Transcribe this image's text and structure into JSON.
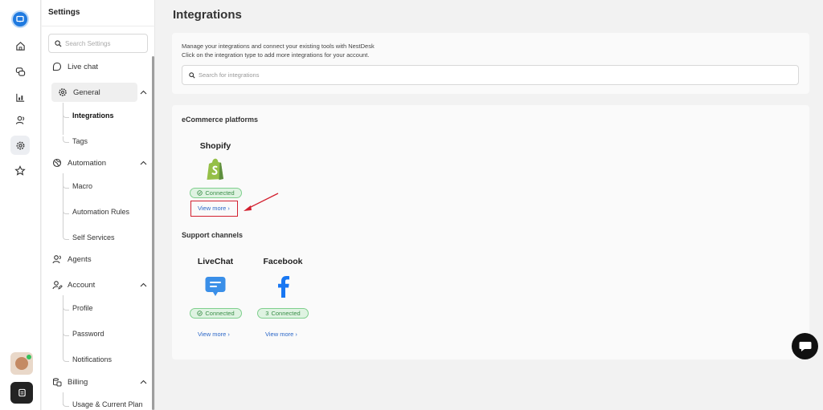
{
  "settings": {
    "title": "Settings",
    "search_placeholder": "Search Settings",
    "nav": {
      "live_chat": "Live chat",
      "general": "General",
      "integrations": "Integrations",
      "tags": "Tags",
      "automation": "Automation",
      "macro": "Macro",
      "automation_rules": "Automation Rules",
      "self_services": "Self Services",
      "agents": "Agents",
      "account": "Account",
      "profile": "Profile",
      "password": "Password",
      "notifications": "Notifications",
      "billing": "Billing",
      "usage": "Usage & Current Plan"
    }
  },
  "main": {
    "title": "Integrations",
    "description_line1": "Manage your integrations and connect your existing tools with NestDesk",
    "description_line2": "Click on the integration type to add more integrations for your account.",
    "search_placeholder": "Search for integrations",
    "ecommerce": {
      "title": "eCommerce platforms",
      "items": [
        {
          "name": "Shopify",
          "status": "Connected",
          "link": "View more ›"
        }
      ]
    },
    "support": {
      "title": "Support channels",
      "items": [
        {
          "name": "LiveChat",
          "status": "Connected",
          "link": "View more ›"
        },
        {
          "name": "Facebook",
          "status_count": "3",
          "status": "Connected",
          "link": "View more ›"
        }
      ]
    }
  },
  "colors": {
    "accent_blue": "#1f7ae0",
    "connected_green": "#3a8e48",
    "link_blue": "#2a66c7",
    "highlight_red": "#d3202f"
  }
}
